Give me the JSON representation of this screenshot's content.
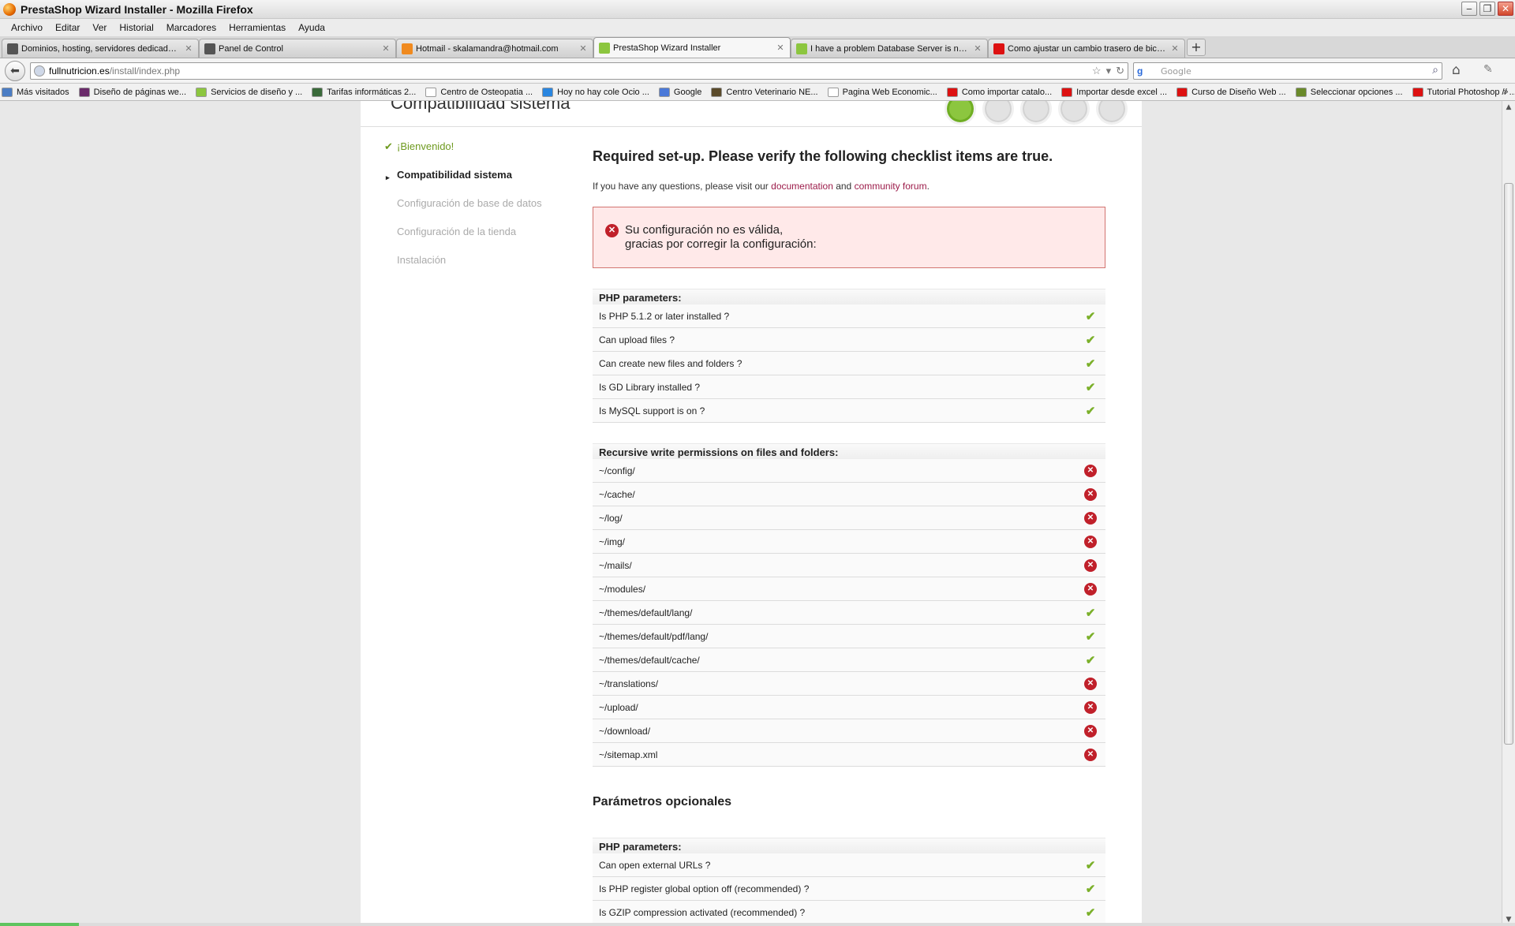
{
  "window": {
    "title": "PrestaShop Wizard Installer - Mozilla Firefox"
  },
  "menu": [
    "Archivo",
    "Editar",
    "Ver",
    "Historial",
    "Marcadores",
    "Herramientas",
    "Ayuda"
  ],
  "tabs": [
    {
      "label": "Dominios, hosting, servidores dedicados,...",
      "icon": "site-icon",
      "color": "#555"
    },
    {
      "label": "Panel de Control",
      "icon": "site-icon",
      "color": "#555"
    },
    {
      "label": "Hotmail - skalamandra@hotmail.com",
      "icon": "hotmail-icon",
      "color": "#f08a1f"
    },
    {
      "label": "PrestaShop Wizard Installer",
      "icon": "prestashop-icon",
      "color": "#8cc63f"
    },
    {
      "label": "I have a problem Database Server is not ...",
      "icon": "prestashop-icon",
      "color": "#8cc63f"
    },
    {
      "label": "Como ajustar un cambio trasero de bicicl...",
      "icon": "youtube-icon",
      "color": "#d11"
    }
  ],
  "active_tab": 3,
  "url": {
    "host": "fullnutricion.es",
    "path": "/install/index.php"
  },
  "search": {
    "placeholder": "Google",
    "engine": "g"
  },
  "bookmarks": [
    {
      "label": "Más visitados",
      "color": "#4b7dc4"
    },
    {
      "label": "Diseño de páginas we...",
      "color": "#6a2a6a"
    },
    {
      "label": "Servicios de diseño y ...",
      "color": "#8cc63f"
    },
    {
      "label": "Tarifas informáticas 2...",
      "color": "#3a6a3a"
    },
    {
      "label": "Centro de Osteopatia ...",
      "color": "#ffffff"
    },
    {
      "label": "Hoy no hay cole Ocio ...",
      "color": "#2a86e0"
    },
    {
      "label": "Google",
      "color": "#4a78d8"
    },
    {
      "label": "Centro Veterinario NE...",
      "color": "#5a4a2a"
    },
    {
      "label": "Pagina Web Economic...",
      "color": "#ffffff"
    },
    {
      "label": "Como importar catalo...",
      "color": "#d11"
    },
    {
      "label": "Importar desde excel ...",
      "color": "#d11"
    },
    {
      "label": "Curso de Diseño Web ...",
      "color": "#d11"
    },
    {
      "label": "Seleccionar opciones ...",
      "color": "#6a8a2a"
    },
    {
      "label": "Tutorial Photoshop // ...",
      "color": "#d11"
    }
  ],
  "page": {
    "heading": "Compatibilidad sistema",
    "steps_done": 1,
    "steps_total": 5,
    "sidebar": [
      {
        "label": "¡Bienvenido!",
        "state": "done",
        "mark": "✔"
      },
      {
        "label": "Compatibilidad sistema",
        "state": "current",
        "mark": "▸"
      },
      {
        "label": "Configuración de base de datos",
        "state": "todo",
        "mark": ""
      },
      {
        "label": "Configuración de la tienda",
        "state": "todo",
        "mark": ""
      },
      {
        "label": "Instalación",
        "state": "todo",
        "mark": ""
      }
    ],
    "intro_title": "Required set-up. Please verify the following checklist items are true.",
    "intro_text_1": "If you have any questions, please visit our ",
    "intro_link_doc": "documentation",
    "intro_text_2": " and ",
    "intro_link_forum": "community forum",
    "intro_text_3": ".",
    "error_line1": "Su configuración no es válida,",
    "error_line2": "gracias por corregir la configuración:",
    "php_header": "PHP parameters:",
    "php_checks": [
      {
        "label": "Is PHP 5.1.2 or later installed ?",
        "ok": true
      },
      {
        "label": "Can upload files ?",
        "ok": true
      },
      {
        "label": "Can create new files and folders ?",
        "ok": true
      },
      {
        "label": "Is GD Library installed ?",
        "ok": true
      },
      {
        "label": "Is MySQL support is on ?",
        "ok": true
      }
    ],
    "perm_header": "Recursive write permissions on files and folders:",
    "perm_checks": [
      {
        "label": "~/config/",
        "ok": false
      },
      {
        "label": "~/cache/",
        "ok": false
      },
      {
        "label": "~/log/",
        "ok": false
      },
      {
        "label": "~/img/",
        "ok": false
      },
      {
        "label": "~/mails/",
        "ok": false
      },
      {
        "label": "~/modules/",
        "ok": false
      },
      {
        "label": "~/themes/default/lang/",
        "ok": true
      },
      {
        "label": "~/themes/default/pdf/lang/",
        "ok": true
      },
      {
        "label": "~/themes/default/cache/",
        "ok": true
      },
      {
        "label": "~/translations/",
        "ok": false
      },
      {
        "label": "~/upload/",
        "ok": false
      },
      {
        "label": "~/download/",
        "ok": false
      },
      {
        "label": "~/sitemap.xml",
        "ok": false
      }
    ],
    "optional_title": "Parámetros opcionales",
    "opt_php_header": "PHP parameters:",
    "opt_checks": [
      {
        "label": "Can open external URLs ?",
        "ok": true
      },
      {
        "label": "Is PHP register global option off (recommended) ?",
        "ok": true
      },
      {
        "label": "Is GZIP compression activated (recommended) ?",
        "ok": true
      }
    ]
  }
}
